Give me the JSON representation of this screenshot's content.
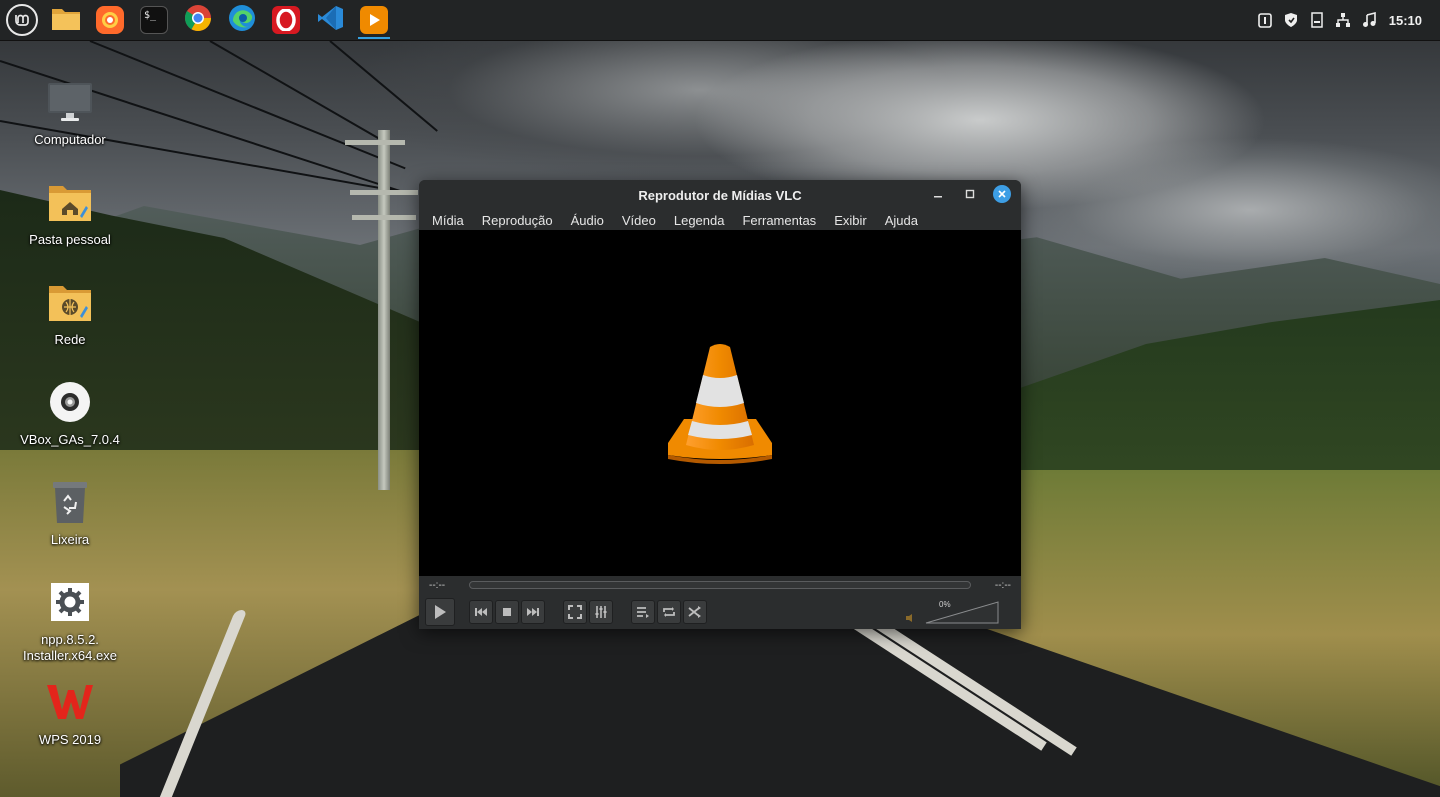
{
  "panel": {
    "launchers": [
      {
        "name": "menu",
        "icon": "linux-mint-menu-icon"
      },
      {
        "name": "files",
        "icon": "folder-icon"
      },
      {
        "name": "firefox",
        "icon": "firefox-icon"
      },
      {
        "name": "terminal",
        "icon": "terminal-icon",
        "glyph": "$_"
      },
      {
        "name": "chrome",
        "icon": "chrome-icon"
      },
      {
        "name": "edge",
        "icon": "edge-icon"
      },
      {
        "name": "opera",
        "icon": "opera-icon"
      },
      {
        "name": "vscode",
        "icon": "vscode-icon"
      },
      {
        "name": "vlc",
        "icon": "vlc-play-icon",
        "active": true
      }
    ],
    "tray": [
      "update-shield-icon",
      "security-icon",
      "notes-icon",
      "network-icon",
      "sound-icon"
    ],
    "clock": "15:10"
  },
  "desktop": {
    "icons": [
      {
        "name": "computer",
        "label": "Computador",
        "icon": "monitor-icon"
      },
      {
        "name": "home",
        "label": "Pasta pessoal",
        "icon": "home-folder-icon"
      },
      {
        "name": "network",
        "label": "Rede",
        "icon": "network-folder-icon"
      },
      {
        "name": "vbox",
        "label": "VBox_GAs_7.0.4",
        "icon": "cd-disc-icon"
      },
      {
        "name": "trash",
        "label": "Lixeira",
        "icon": "trash-icon"
      },
      {
        "name": "npp",
        "label": "npp.8.5.2.\nInstaller.x64.exe",
        "icon": "gear-executable-icon"
      },
      {
        "name": "wps",
        "label": "WPS 2019",
        "icon": "wps-office-icon"
      }
    ]
  },
  "vlc": {
    "title": "Reprodutor de Mídias VLC",
    "menu": [
      "Mídia",
      "Reprodução",
      "Áudio",
      "Vídeo",
      "Legenda",
      "Ferramentas",
      "Exibir",
      "Ajuda"
    ],
    "time_elapsed": "--:--",
    "time_total": "--:--",
    "volume_text": "0%",
    "accent": "#3d9ee5",
    "cone_color": "#f08a00"
  }
}
